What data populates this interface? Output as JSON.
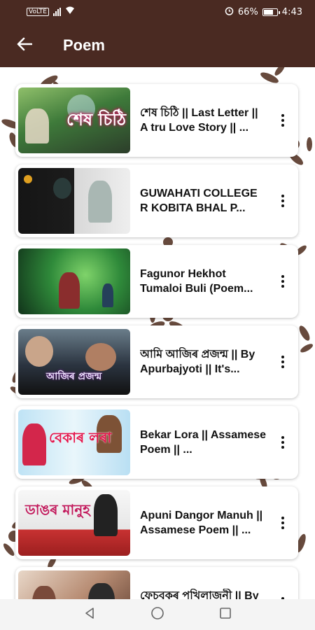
{
  "status_bar": {
    "left_text": "VoLTE",
    "battery_percent": "66%",
    "battery_level": 0.66,
    "time": "4:43",
    "icons": [
      "signal-icon",
      "wifi-icon",
      "alarm-icon",
      "battery-icon"
    ]
  },
  "app_bar": {
    "title": "Poem",
    "back_icon": "arrow-left-icon",
    "background": "#4a2a22"
  },
  "videos": [
    {
      "title": "শেষ চিঠি || Last Letter || A tru Love Story || ...",
      "thumb_caption": "শেষ চিঠি"
    },
    {
      "title": "GUWAHATI COLLEGE R KOBITA BHAL P...",
      "thumb_caption": ""
    },
    {
      "title": "Fagunor Hekhot Tumaloi Buli (Poem...",
      "thumb_caption": ""
    },
    {
      "title": "আমি আজিৰ প্ৰজন্ম || By Apurbajyoti || It's...",
      "thumb_caption": "আজিৰ প্ৰজন্ম"
    },
    {
      "title": "Bekar Lora || Assamese Poem || ...",
      "thumb_caption": "বেকাৰ লৰা"
    },
    {
      "title": "Apuni Dangor Manuh || Assamese Poem || ...",
      "thumb_caption": "ডাঙৰ মানুহ"
    },
    {
      "title": "ফেচবুকৰ পখিলাজনী || By Apurbajyoti || A...",
      "thumb_caption": ""
    }
  ],
  "colors": {
    "accent": "#4a2a22",
    "decoration": "#5a3a2c"
  },
  "nav_bar": {
    "icons": [
      "back-triangle-icon",
      "home-circle-icon",
      "recents-square-icon"
    ]
  }
}
